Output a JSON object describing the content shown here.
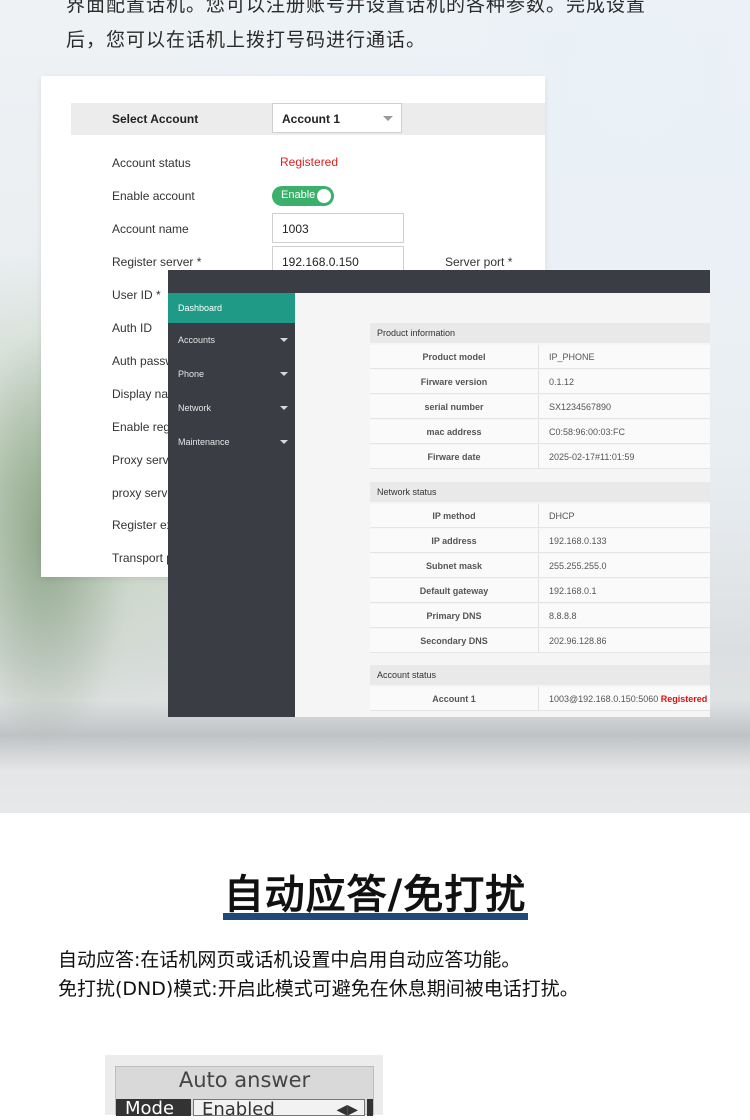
{
  "intro": {
    "line1": "界面配置话机。您可以注册账号并设置话机的各种参数。完成设置",
    "line2": "后，您可以在话机上拨打号码进行通话。"
  },
  "account_panel": {
    "select_label": "Select Account",
    "select_value": "Account 1",
    "fields": {
      "account_status": "Account status",
      "account_status_value": "Registered",
      "enable_account": "Enable account",
      "enable_toggle": "Enable",
      "account_name": "Account name",
      "account_name_value": "1003",
      "register_server": "Register server *",
      "register_server_value": "192.168.0.150",
      "server_port": "Server port *",
      "user_id": "User ID *",
      "auth_id": "Auth ID",
      "auth_password": "Auth passw",
      "display_name": "Display nar",
      "enable_reg": "Enable reg",
      "proxy_server": "Proxy serv",
      "proxy_server2": "proxy serve",
      "register_expire": "Register ex",
      "transport": "Transport p"
    }
  },
  "dashboard": {
    "sidebar": [
      {
        "label": "Dashboard",
        "active": true
      },
      {
        "label": "Accounts"
      },
      {
        "label": "Phone"
      },
      {
        "label": "Network"
      },
      {
        "label": "Maintenance"
      }
    ],
    "product_info": {
      "title": "Product information",
      "rows": [
        {
          "k": "Product model",
          "v": "IP_PHONE"
        },
        {
          "k": "Firware version",
          "v": "0.1.12"
        },
        {
          "k": "serial number",
          "v": "SX1234567890"
        },
        {
          "k": "mac address",
          "v": "C0:58:96:00:03:FC"
        },
        {
          "k": "Firware date",
          "v": "2025-02-17#11:01:59"
        }
      ]
    },
    "network_status": {
      "title": "Network status",
      "rows": [
        {
          "k": "IP method",
          "v": "DHCP"
        },
        {
          "k": "IP address",
          "v": "192.168.0.133"
        },
        {
          "k": "Subnet mask",
          "v": "255.255.255.0"
        },
        {
          "k": "Default gateway",
          "v": "192.168.0.1"
        },
        {
          "k": "Primary DNS",
          "v": "8.8.8.8"
        },
        {
          "k": "Secondary DNS",
          "v": "202.96.128.86"
        }
      ]
    },
    "account_status": {
      "title": "Account status",
      "row_k": "Account 1",
      "row_v": "1003@192.168.0.150:5060",
      "row_status": "Registered"
    }
  },
  "section2": {
    "title": "自动应答/免打扰",
    "desc1": "自动应答:在话机网页或话机设置中启用自动应答功能。",
    "desc2": "免打扰(DND)模式:开启此模式可避免在休息期间被电话打扰。",
    "phone_title": "Auto answer",
    "phone_mode": "Mode",
    "phone_value": "Enabled",
    "phone_arrows": "◀▶"
  },
  "colors": {
    "accent_teal": "#1f9a86",
    "sidebar_dark": "#3a3d44",
    "registered_red": "#e02020",
    "underline_blue": "#1e4a7a",
    "toggle_green": "#3bb06b"
  }
}
